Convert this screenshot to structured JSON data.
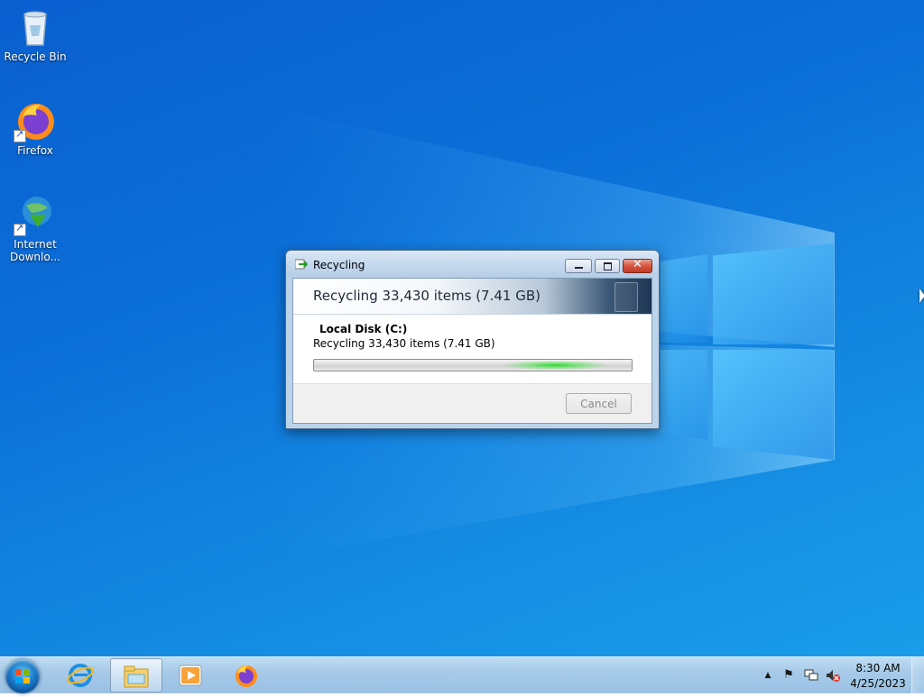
{
  "desktop": {
    "icons": [
      {
        "label": "Recycle Bin",
        "icon": "recycle-bin-icon"
      },
      {
        "label": "Firefox",
        "icon": "firefox-icon"
      },
      {
        "label": "Internet Downlo...",
        "icon": "internet-download-manager-icon"
      }
    ]
  },
  "dialog": {
    "title": "Recycling",
    "banner": "Recycling 33,430 items (7.41 GB)",
    "source_title": "Local Disk (C:)",
    "source_status": "Recycling 33,430 items (7.41 GB)",
    "progress_state": "indeterminate",
    "cancel_label": "Cancel",
    "buttons": {
      "minimize": "minimize-icon",
      "maximize": "maximize-icon",
      "close": "close-icon"
    }
  },
  "taskbar": {
    "start": "start-orb-icon",
    "pinned": [
      {
        "name": "internet-explorer-icon",
        "active": false
      },
      {
        "name": "file-explorer-icon",
        "active": true
      },
      {
        "name": "media-player-icon",
        "active": false
      },
      {
        "name": "firefox-icon",
        "active": false
      }
    ],
    "tray": {
      "icons": [
        "show-hidden-icons-icon",
        "action-center-flag-icon",
        "network-icon",
        "volume-muted-icon"
      ],
      "time": "8:30 AM",
      "date": "4/25/2023"
    }
  },
  "colors": {
    "desktop_blue": "#0b6fd8",
    "banner_dark": "#1d3654",
    "progress_green": "#28dc28",
    "close_red": "#c13b24"
  }
}
